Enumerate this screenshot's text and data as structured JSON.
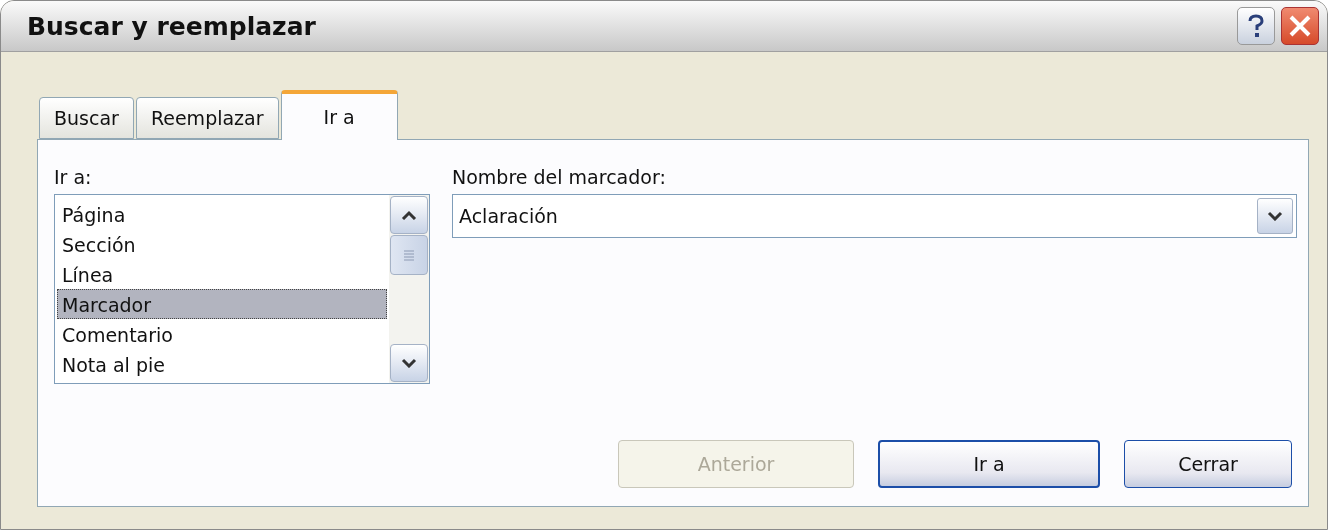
{
  "window": {
    "title": "Buscar y reemplazar"
  },
  "tabs": [
    {
      "label": "Buscar",
      "selected": false
    },
    {
      "label": "Reemplazar",
      "selected": false
    },
    {
      "label": "Ir a",
      "selected": true
    }
  ],
  "goto_list": {
    "label": "Ir a:",
    "items": [
      {
        "label": "Página",
        "selected": false
      },
      {
        "label": "Sección",
        "selected": false
      },
      {
        "label": "Línea",
        "selected": false
      },
      {
        "label": "Marcador",
        "selected": true
      },
      {
        "label": "Comentario",
        "selected": false
      },
      {
        "label": "Nota al pie",
        "selected": false
      }
    ]
  },
  "bookmark": {
    "label": "Nombre del marcador:",
    "value": "Aclaración"
  },
  "buttons": [
    {
      "label": "Anterior",
      "disabled": true,
      "default": false
    },
    {
      "label": "Ir a",
      "disabled": false,
      "default": true
    },
    {
      "label": "Cerrar",
      "disabled": false,
      "default": false
    }
  ]
}
